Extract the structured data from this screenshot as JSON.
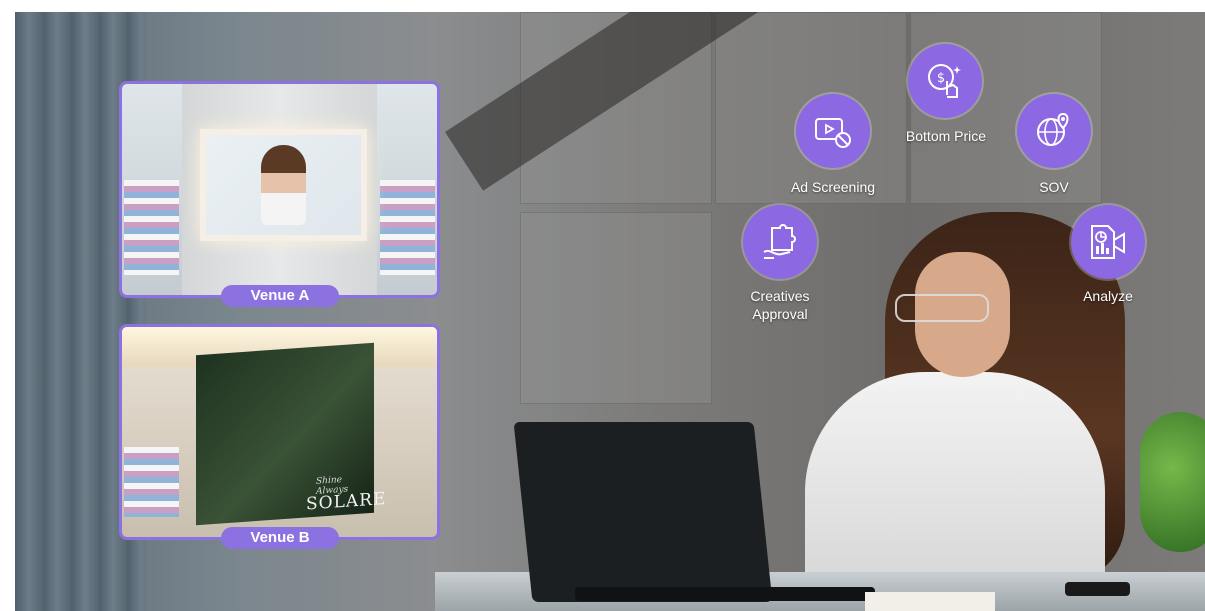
{
  "venues": [
    {
      "label": "Venue A"
    },
    {
      "label": "Venue B",
      "screen_text_small": "Shine Always",
      "screen_text_brand": "SOLARE"
    }
  ],
  "features": {
    "ad_screening": "Ad Screening",
    "bottom_price": "Bottom Price",
    "sov": "SOV",
    "creatives_approval_line1": "Creatives",
    "creatives_approval_line2": "Approval",
    "analyze": "Analyze"
  },
  "colors": {
    "accent": "#8c68e2",
    "frame": "#8c72e0"
  },
  "icons": [
    "video-blocked-icon",
    "price-touch-icon",
    "globe-location-icon",
    "puzzle-hand-icon",
    "report-megaphone-icon"
  ]
}
